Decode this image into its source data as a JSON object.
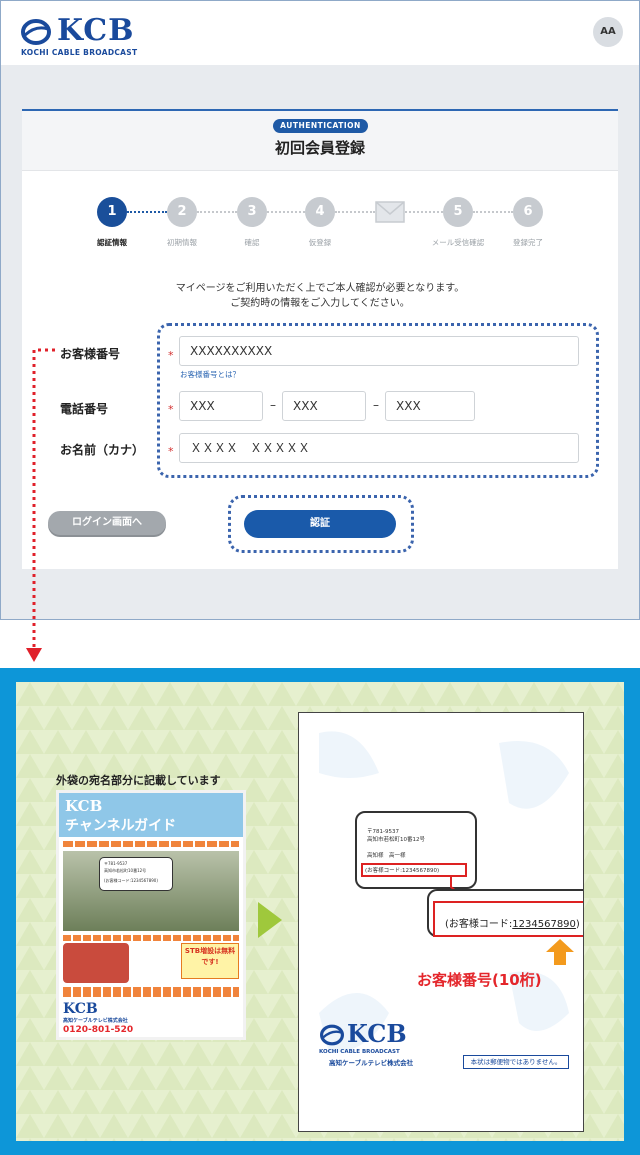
{
  "header": {
    "logo_text": "KCB",
    "logo_subtitle": "KOCHI CABLE BROADCAST",
    "font_size_button": "AA"
  },
  "form": {
    "badge": "AUTHENTICATION",
    "title": "初回会員登録",
    "steps": [
      {
        "number": "1",
        "label": "認証情報",
        "active": true
      },
      {
        "number": "2",
        "label": "初期情報",
        "active": false
      },
      {
        "number": "3",
        "label": "確認",
        "active": false
      },
      {
        "number": "4",
        "label": "仮登録",
        "active": false
      },
      {
        "number": "5",
        "label": "メール受信確認",
        "active": false
      },
      {
        "number": "6",
        "label": "登録完了",
        "active": false
      }
    ],
    "intro_line1": "マイページをご利用いただく上でご本人確認が必要となります。",
    "intro_line2": "ご契約時の情報をご入力してください。",
    "customer_number": {
      "label": "お客様番号",
      "value": "XXXXXXXXXX",
      "help": "お客様番号とは？"
    },
    "phone": {
      "label": "電話番号",
      "part1": "XXX",
      "part2": "XXX",
      "part3": "XXX",
      "separator": "–"
    },
    "name_kana": {
      "label": "お名前（カナ）",
      "value": "ＸＸＸＸ　ＸＸＸＸＸ"
    },
    "required_mark": "*",
    "login_button": "ログイン画面へ",
    "auth_button": "認証"
  },
  "guide": {
    "caption": "外袋の宛名部分に記載しています",
    "mailer_title": "チャンネルガイド",
    "mailer_banner": "STB増設は無料です!",
    "mailer_phone": "0120-801-520",
    "envelope": {
      "postal": "〒781-9537",
      "address": "高知市若松町10番12号",
      "name_line": "高知様　高一様",
      "code_small": "(お客様コード:1234567890)",
      "code_large_prefix": "(お客様コード:",
      "code_large_value": "1234567890",
      "code_large_suffix": ")",
      "label": "お客様番号(10桁)",
      "company": "高知ケーブルテレビ株式会社",
      "notice": "本状は郵便物ではありません。",
      "logo_text": "KCB",
      "logo_subtitle": "KOCHI CABLE BROADCAST"
    }
  },
  "colors": {
    "brand": "#1a4a9c",
    "primary_button": "#1a5aaa",
    "highlight": "#3b64ad",
    "alert": "#e4262b",
    "panel": "#0d96d8",
    "arrow_green": "#9fc83c",
    "arrow_orange": "#f39a1d"
  }
}
